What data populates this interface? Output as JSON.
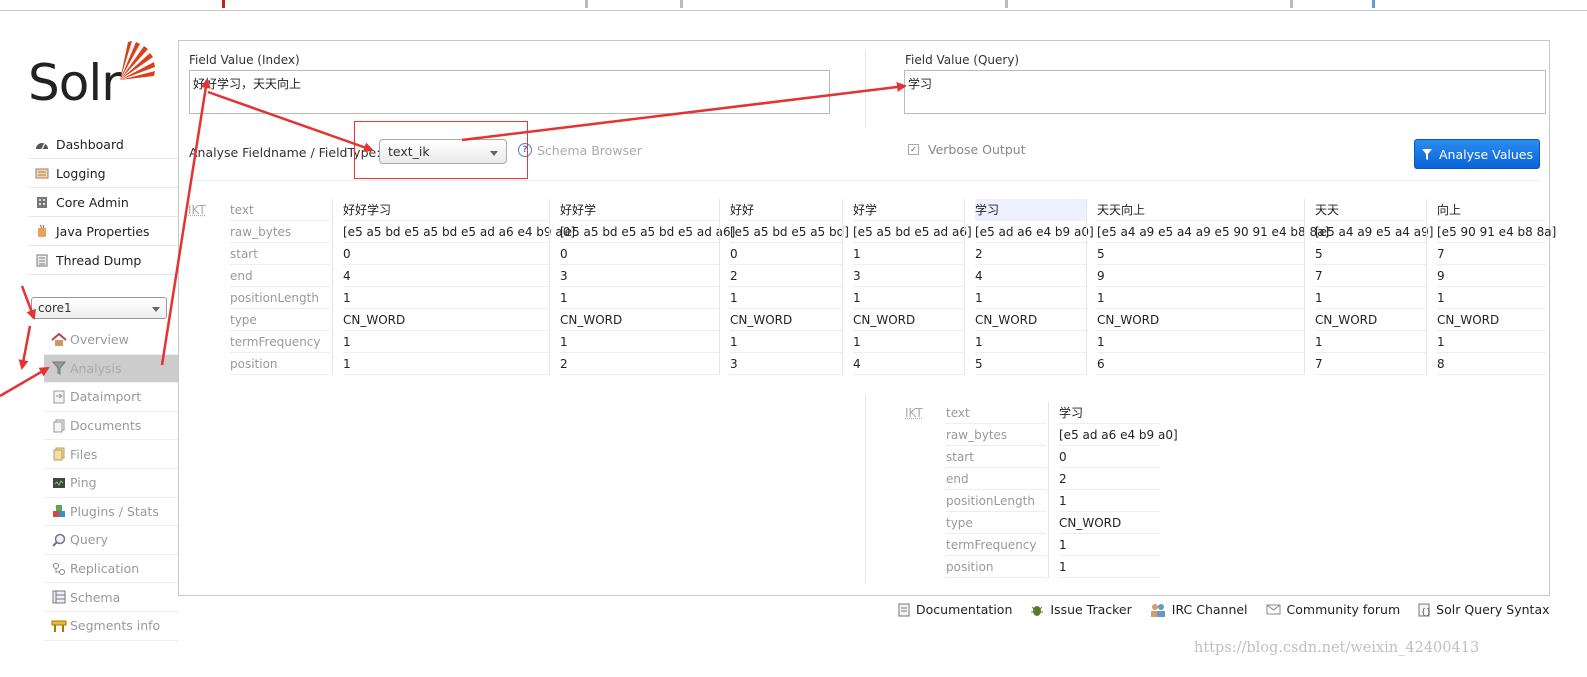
{
  "logo": {
    "text": "Solr"
  },
  "sidebar": {
    "items": [
      {
        "label": "Dashboard",
        "icon": "dashboard-icon"
      },
      {
        "label": "Logging",
        "icon": "logging-icon"
      },
      {
        "label": "Core Admin",
        "icon": "core-admin-icon"
      },
      {
        "label": "Java Properties",
        "icon": "java-properties-icon"
      },
      {
        "label": "Thread Dump",
        "icon": "thread-dump-icon"
      }
    ],
    "core_selector": "core1",
    "core_items": [
      {
        "label": "Overview",
        "icon": "home-icon"
      },
      {
        "label": "Analysis",
        "icon": "funnel-icon"
      },
      {
        "label": "Dataimport",
        "icon": "dataimport-icon"
      },
      {
        "label": "Documents",
        "icon": "documents-icon"
      },
      {
        "label": "Files",
        "icon": "files-icon"
      },
      {
        "label": "Ping",
        "icon": "ping-icon"
      },
      {
        "label": "Plugins / Stats",
        "icon": "plugins-icon"
      },
      {
        "label": "Query",
        "icon": "query-icon"
      },
      {
        "label": "Replication",
        "icon": "replication-icon"
      },
      {
        "label": "Schema",
        "icon": "schema-icon"
      },
      {
        "label": "Segments info",
        "icon": "segments-icon"
      }
    ]
  },
  "analysis": {
    "index_label": "Field Value (Index)",
    "index_value": "好好学习，天天向上",
    "query_label": "Field Value (Query)",
    "query_value": "学习",
    "fieldtype_label": "Analyse Fieldname / FieldType:",
    "fieldtype_value": "text_ik",
    "schema_browser": "Schema Browser",
    "verbose_label": "Verbose Output",
    "analyse_button": "Analyse Values",
    "analyzer": "IKT",
    "attributes": [
      "text",
      "raw_bytes",
      "start",
      "end",
      "positionLength",
      "type",
      "termFrequency",
      "position"
    ],
    "index_tokens": [
      [
        "好好学习",
        "[e5 a5 bd e5 a5 bd e5 ad a6 e4 b9 a0]",
        "0",
        "4",
        "1",
        "CN_WORD",
        "1",
        "1"
      ],
      [
        "好好学",
        "[e5 a5 bd e5 a5 bd e5 ad a6]",
        "0",
        "3",
        "1",
        "CN_WORD",
        "1",
        "2"
      ],
      [
        "好好",
        "[e5 a5 bd e5 a5 bd]",
        "0",
        "2",
        "1",
        "CN_WORD",
        "1",
        "3"
      ],
      [
        "好学",
        "[e5 a5 bd e5 ad a6]",
        "1",
        "3",
        "1",
        "CN_WORD",
        "1",
        "4"
      ],
      [
        "学习",
        "[e5 ad a6 e4 b9 a0]",
        "2",
        "4",
        "1",
        "CN_WORD",
        "1",
        "5"
      ],
      [
        "天天向上",
        "[e5 a4 a9 e5 a4 a9 e5 90 91 e4 b8 8a]",
        "5",
        "9",
        "1",
        "CN_WORD",
        "1",
        "6"
      ],
      [
        "天天",
        "[e5 a4 a9 e5 a4 a9]",
        "5",
        "7",
        "1",
        "CN_WORD",
        "1",
        "7"
      ],
      [
        "向上",
        "[e5 90 91 e4 b8 8a]",
        "7",
        "9",
        "1",
        "CN_WORD",
        "1",
        "8"
      ]
    ],
    "query_tokens": [
      [
        "学习",
        "[e5 ad a6 e4 b9 a0]",
        "0",
        "2",
        "1",
        "CN_WORD",
        "1",
        "1"
      ]
    ]
  },
  "footer": [
    {
      "label": "Documentation",
      "icon": "documentation-icon"
    },
    {
      "label": "Issue Tracker",
      "icon": "bug-icon"
    },
    {
      "label": "IRC Channel",
      "icon": "irc-icon"
    },
    {
      "label": "Community forum",
      "icon": "mail-icon"
    },
    {
      "label": "Solr Query Syntax",
      "icon": "syntax-icon"
    }
  ],
  "watermark": "https://blog.csdn.net/weixin_42400413",
  "colors": {
    "accent_button": "#1a73e8",
    "annotation_red": "#e33333",
    "solr_orange": "#d9411e"
  }
}
